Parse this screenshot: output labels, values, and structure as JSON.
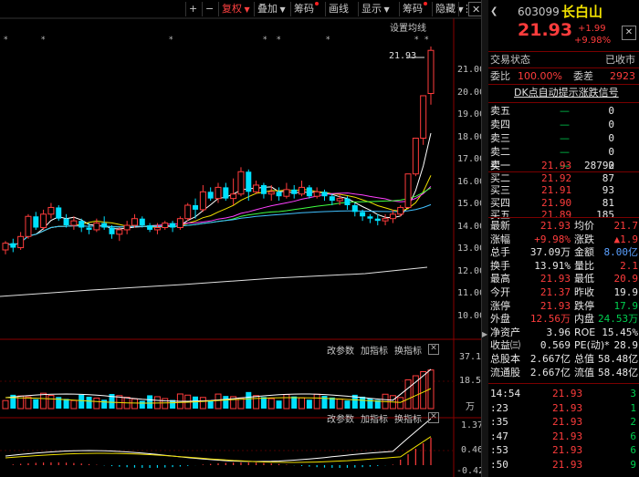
{
  "toolbar": {
    "plus": "+",
    "minus": "−",
    "fuquan": "复权",
    "diejia": "叠加",
    "chouma": "筹码",
    "huaxian": "画线",
    "xianshi": "显示",
    "chouma2": "筹码",
    "yincang": "隐藏",
    "more": "⋮",
    "close": "✕"
  },
  "main_chart": {
    "settings_label": "设置均线",
    "price_tag": "21.93",
    "y_ticks": [
      "21.00",
      "20.00",
      "19.00",
      "18.00",
      "17.00",
      "16.00",
      "15.00",
      "14.00",
      "13.00",
      "12.00",
      "11.00",
      "10.00"
    ]
  },
  "vol_panel": {
    "btn1": "改参数",
    "btn2": "加指标",
    "btn3": "换指标",
    "close": "✕",
    "y_ticks": [
      "37.10",
      "18.55",
      "万"
    ]
  },
  "macd_panel": {
    "btn1": "改参数",
    "btn2": "加指标",
    "btn3": "换指标",
    "close": "✕",
    "y_ticks": [
      "1.37",
      "0.46",
      "-0.42"
    ]
  },
  "chart_data": {
    "type": "candlestick",
    "ylim": [
      10,
      22
    ],
    "candles": [
      [
        13.0,
        13.3,
        12.8,
        13.4
      ],
      [
        13.3,
        13.1,
        12.9,
        13.5
      ],
      [
        13.1,
        13.6,
        13.0,
        13.8
      ],
      [
        13.6,
        14.5,
        13.5,
        14.6
      ],
      [
        14.5,
        14.0,
        13.9,
        14.7
      ],
      [
        14.0,
        14.6,
        13.9,
        14.8
      ],
      [
        14.6,
        14.9,
        14.4,
        15.1
      ],
      [
        14.9,
        14.4,
        14.3,
        15.0
      ],
      [
        14.4,
        14.1,
        14.0,
        14.6
      ],
      [
        14.1,
        14.3,
        13.9,
        14.5
      ],
      [
        14.3,
        14.0,
        13.8,
        14.4
      ],
      [
        14.0,
        13.9,
        13.7,
        14.2
      ],
      [
        13.9,
        14.2,
        13.8,
        14.4
      ],
      [
        14.2,
        14.0,
        13.9,
        14.5
      ],
      [
        14.0,
        13.7,
        13.5,
        14.1
      ],
      [
        13.7,
        13.9,
        13.4,
        14.0
      ],
      [
        13.9,
        14.1,
        13.7,
        14.3
      ],
      [
        14.1,
        14.4,
        14.0,
        14.6
      ],
      [
        14.4,
        14.1,
        14.0,
        14.5
      ],
      [
        14.1,
        13.9,
        13.8,
        14.2
      ],
      [
        13.9,
        14.0,
        13.7,
        14.2
      ],
      [
        14.0,
        14.2,
        13.9,
        14.3
      ],
      [
        14.2,
        14.0,
        13.8,
        14.3
      ],
      [
        14.0,
        14.4,
        13.9,
        14.5
      ],
      [
        14.4,
        15.0,
        14.3,
        15.1
      ],
      [
        15.0,
        14.8,
        14.4,
        15.3
      ],
      [
        14.8,
        15.6,
        14.7,
        15.9
      ],
      [
        15.6,
        15.3,
        15.2,
        15.8
      ],
      [
        15.3,
        15.8,
        15.1,
        16.0
      ],
      [
        15.8,
        15.3,
        15.2,
        16.0
      ],
      [
        15.3,
        15.5,
        15.0,
        16.2
      ],
      [
        15.5,
        16.5,
        15.4,
        16.7
      ],
      [
        16.5,
        15.6,
        15.2,
        16.6
      ],
      [
        15.6,
        15.9,
        15.5,
        16.1
      ],
      [
        15.9,
        15.5,
        15.3,
        16.0
      ],
      [
        15.5,
        15.6,
        15.2,
        15.9
      ],
      [
        15.6,
        15.4,
        15.2,
        15.8
      ],
      [
        15.4,
        15.7,
        15.3,
        16.0
      ],
      [
        15.7,
        15.5,
        15.3,
        15.9
      ],
      [
        15.5,
        15.8,
        15.4,
        16.1
      ],
      [
        15.8,
        15.4,
        15.3,
        15.9
      ],
      [
        15.4,
        15.6,
        15.3,
        15.8
      ],
      [
        15.6,
        15.4,
        15.2,
        15.7
      ],
      [
        15.4,
        15.2,
        15.0,
        15.5
      ],
      [
        15.2,
        15.3,
        15.0,
        15.5
      ],
      [
        15.3,
        15.0,
        14.8,
        15.4
      ],
      [
        15.0,
        14.7,
        14.5,
        15.1
      ],
      [
        14.7,
        14.5,
        14.3,
        14.8
      ],
      [
        14.5,
        14.4,
        14.2,
        14.6
      ],
      [
        14.4,
        14.3,
        14.1,
        14.6
      ],
      [
        14.3,
        14.4,
        14.1,
        14.6
      ],
      [
        14.4,
        14.6,
        14.2,
        14.8
      ],
      [
        14.6,
        14.9,
        14.5,
        15.0
      ],
      [
        14.9,
        16.4,
        14.9,
        16.4
      ],
      [
        16.4,
        18.0,
        16.3,
        18.0
      ],
      [
        18.0,
        19.9,
        17.7,
        19.9
      ],
      [
        20.0,
        21.93,
        19.5,
        22.1
      ]
    ]
  },
  "right_panel": {
    "code": "603099",
    "name": "长白山",
    "price": "21.93",
    "chg": "+1.99",
    "pct": "+9.98%",
    "status_label": "交易状态",
    "status_value": "已收市",
    "weibi_label": "委比",
    "weibi_value": "100.00%",
    "weicha_label": "委差",
    "weicha_value": "2923",
    "signal": "DK点自动提示涨跌信号",
    "asks": [
      {
        "label": "卖五",
        "price": "—",
        "vol": "0"
      },
      {
        "label": "卖四",
        "price": "—",
        "vol": "0"
      },
      {
        "label": "卖三",
        "price": "—",
        "vol": "0"
      },
      {
        "label": "卖二",
        "price": "—",
        "vol": "0"
      },
      {
        "label": "卖一",
        "price": "—",
        "vol": "0"
      }
    ],
    "bids": [
      {
        "label": "买一",
        "price": "21.93",
        "vol": "28792"
      },
      {
        "label": "买二",
        "price": "21.92",
        "vol": "87"
      },
      {
        "label": "买三",
        "price": "21.91",
        "vol": "93"
      },
      {
        "label": "买四",
        "price": "21.90",
        "vol": "81"
      },
      {
        "label": "买五",
        "price": "21.89",
        "vol": "185"
      }
    ],
    "stats": [
      {
        "l1": "最新",
        "v1": "21.93",
        "c1": "red",
        "l2": "均价",
        "v2": "21.7",
        "c2": "red"
      },
      {
        "l1": "涨幅",
        "v1": "+9.98%",
        "c1": "red",
        "l2": "涨跌",
        "v2": "▲1.9",
        "c2": "red"
      },
      {
        "l1": "总手",
        "v1": "37.09万",
        "c1": "white",
        "l2": "金额",
        "v2": "8.00亿",
        "c2": "blue"
      },
      {
        "l1": "换手",
        "v1": "13.91%",
        "c1": "white",
        "l2": "量比",
        "v2": "2.1",
        "c2": "red"
      },
      {
        "l1": "最高",
        "v1": "21.93",
        "c1": "red",
        "l2": "最低",
        "v2": "20.9",
        "c2": "red"
      },
      {
        "l1": "今开",
        "v1": "21.37",
        "c1": "red",
        "l2": "昨收",
        "v2": "19.9",
        "c2": "white"
      },
      {
        "l1": "涨停",
        "v1": "21.93",
        "c1": "red",
        "l2": "跌停",
        "v2": "17.9",
        "c2": "green"
      },
      {
        "l1": "外盘",
        "v1": "12.56万",
        "c1": "red",
        "l2": "内盘",
        "v2": "24.53万",
        "c2": "green"
      },
      {
        "l1": "净资产",
        "v1": "3.96",
        "c1": "white",
        "l2": "ROE",
        "v2": "15.45%",
        "c2": "white"
      },
      {
        "l1": "收益㈢",
        "v1": "0.569",
        "c1": "white",
        "l2": "PE(动)*",
        "v2": "28.9",
        "c2": "white"
      },
      {
        "l1": "总股本",
        "v1": "2.667亿",
        "c1": "white",
        "l2": "总值",
        "v2": "58.48亿",
        "c2": "white"
      },
      {
        "l1": "流通股",
        "v1": "2.667亿",
        "c1": "white",
        "l2": "流值",
        "v2": "58.48亿",
        "c2": "white"
      }
    ],
    "ticks": [
      {
        "t": "14:54",
        "p": "21.93",
        "v": "3"
      },
      {
        "t": ":23",
        "p": "21.93",
        "v": "1"
      },
      {
        "t": ":35",
        "p": "21.93",
        "v": "2"
      },
      {
        "t": ":47",
        "p": "21.93",
        "v": "6"
      },
      {
        "t": ":53",
        "p": "21.93",
        "v": "6"
      },
      {
        "t": ":50",
        "p": "21.93",
        "v": "9"
      }
    ]
  },
  "colors": {
    "up": "#ff3c3c",
    "down": "#00e0ff",
    "bg": "#000000"
  }
}
